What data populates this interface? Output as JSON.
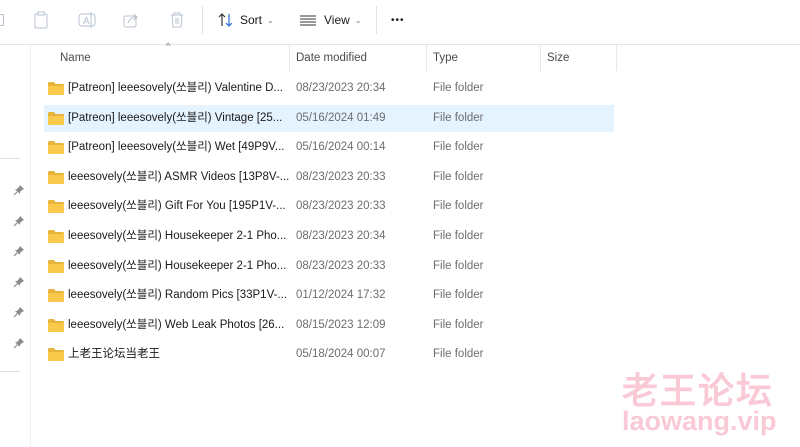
{
  "toolbar": {
    "sort_label": "Sort",
    "view_label": "View",
    "more_label": "•••"
  },
  "columns": {
    "name": "Name",
    "date": "Date modified",
    "type": "Type",
    "size": "Size"
  },
  "files": [
    {
      "name": "[Patreon] leeesovely(쏘블리) Valentine D...",
      "date": "08/23/2023 20:34",
      "type": "File folder",
      "size": ""
    },
    {
      "name": "[Patreon] leeesovely(쏘블리) Vintage [25...",
      "date": "05/16/2024 01:49",
      "type": "File folder",
      "size": "",
      "selected": true
    },
    {
      "name": "[Patreon] leeesovely(쏘블리) Wet [49P9V...",
      "date": "05/16/2024 00:14",
      "type": "File folder",
      "size": ""
    },
    {
      "name": "leeesovely(쏘블리) ASMR Videos [13P8V-...",
      "date": "08/23/2023 20:33",
      "type": "File folder",
      "size": ""
    },
    {
      "name": "leeesovely(쏘블리) Gift For You [195P1V-...",
      "date": "08/23/2023 20:33",
      "type": "File folder",
      "size": ""
    },
    {
      "name": "leeesovely(쏘블리) Housekeeper 2-1 Pho...",
      "date": "08/23/2023 20:34",
      "type": "File folder",
      "size": ""
    },
    {
      "name": "leeesovely(쏘블리) Housekeeper 2-1 Pho...",
      "date": "08/23/2023 20:33",
      "type": "File folder",
      "size": ""
    },
    {
      "name": "leeesovely(쏘블리) Random Pics [33P1V-...",
      "date": "01/12/2024 17:32",
      "type": "File folder",
      "size": ""
    },
    {
      "name": "leeesovely(쏘블리) Web Leak Photos [26...",
      "date": "08/15/2023 12:09",
      "type": "File folder",
      "size": ""
    },
    {
      "name": "上老王论坛当老王",
      "date": "05/18/2024 00:07",
      "type": "File folder",
      "size": ""
    }
  ],
  "watermark": {
    "line1": "老王论坛",
    "line2": "laowang.vip",
    "color": "#f9c9d6"
  },
  "colors": {
    "selected_row": "#e5f3ff",
    "folder": "#f8c94a"
  }
}
